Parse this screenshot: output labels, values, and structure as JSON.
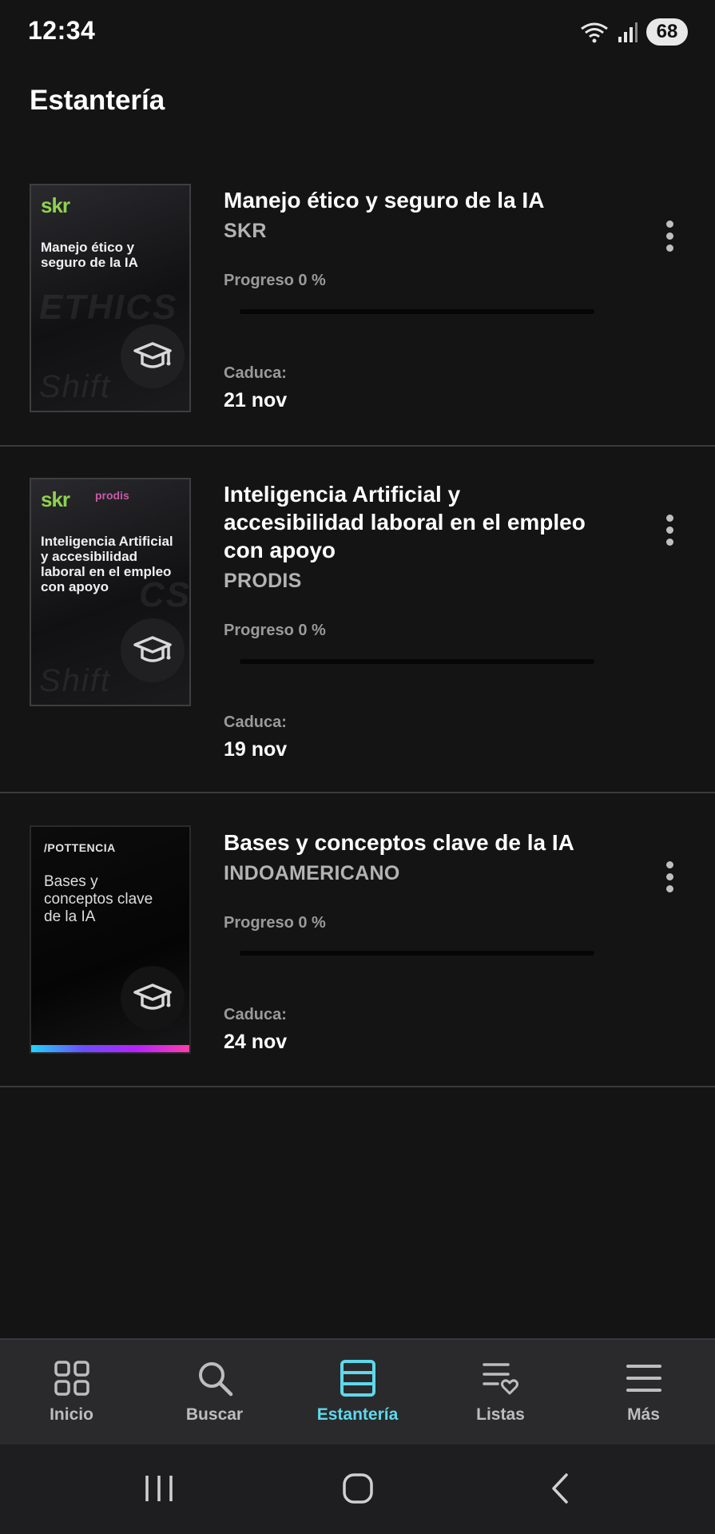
{
  "status_bar": {
    "time": "12:34",
    "battery": "68"
  },
  "page": {
    "title": "Estantería"
  },
  "books": [
    {
      "title": "Manejo ético y seguro de la IA",
      "author": "SKR",
      "progress_label": "Progreso 0 %",
      "progress": 0,
      "expires_label": "Caduca:",
      "expires_date": "21 nov",
      "cover": {
        "logo": "skr",
        "title": "Manejo ético y seguro de la IA",
        "bg_word": "ETHICS",
        "bg_word2": "Shift"
      }
    },
    {
      "title": "Inteligencia Artificial y accesibilidad laboral en el empleo con apoyo",
      "author": "PRODIS",
      "progress_label": "Progreso 0 %",
      "progress": 0,
      "expires_label": "Caduca:",
      "expires_date": "19 nov",
      "cover": {
        "logo": "skr",
        "logo2": "prodis",
        "title": "Inteligencia Artificial y accesibilidad laboral en el empleo con apoyo",
        "bg_word": "CS",
        "bg_word2": "Shift"
      }
    },
    {
      "title": "Bases y conceptos clave de la IA",
      "author": "INDOAMERICANO",
      "progress_label": "Progreso 0 %",
      "progress": 0,
      "expires_label": "Caduca:",
      "expires_date": "24 nov",
      "cover": {
        "logo": "/POTTENCIA",
        "title": "Bases y conceptos clave de la IA"
      }
    }
  ],
  "nav": {
    "items": [
      {
        "label": "Inicio",
        "icon": "grid-icon"
      },
      {
        "label": "Buscar",
        "icon": "search-icon"
      },
      {
        "label": "Estantería",
        "icon": "shelf-icon",
        "active": true
      },
      {
        "label": "Listas",
        "icon": "list-heart-icon"
      },
      {
        "label": "Más",
        "icon": "menu-icon"
      }
    ]
  },
  "colors": {
    "accent": "#5fd8ea",
    "background": "#141415",
    "nav_background": "#2a2a2c"
  }
}
